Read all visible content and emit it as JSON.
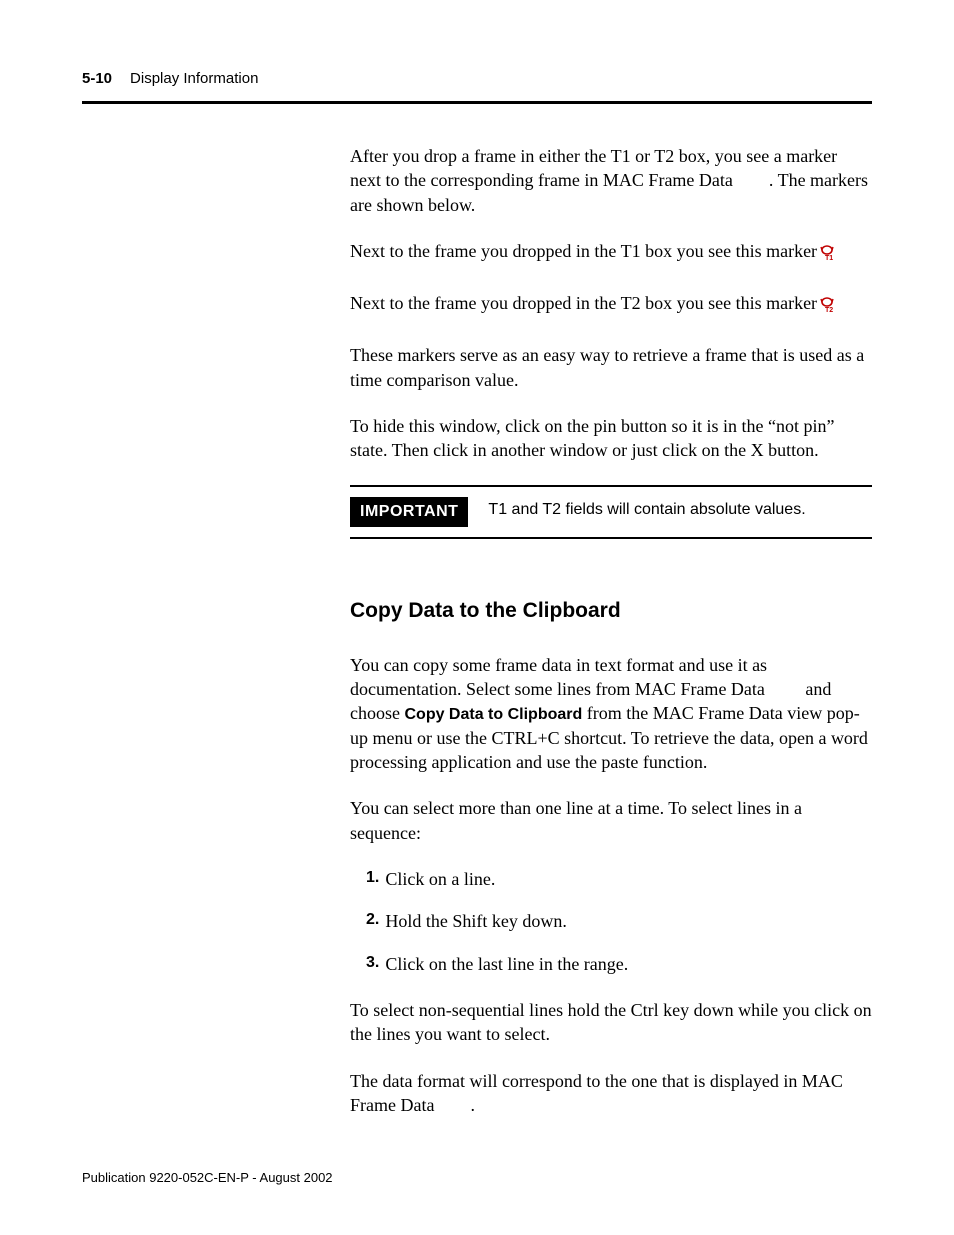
{
  "header": {
    "page_number": "5-10",
    "section": "Display Information"
  },
  "body": {
    "p1": "After you drop a frame in either the T1 or T2 box, you see a marker next to the corresponding frame in MAC Frame Data  . The markers are shown below.",
    "marker_t1_text": "Next to the frame you dropped in the T1 box you see this marker",
    "marker_t2_text": "Next to the frame you dropped in the T2 box you see this marker",
    "p2": "These markers serve as an easy way to retrieve a frame that is used as a time comparison value.",
    "p3": "To hide this window, click on the pin button so it is in the “not pin” state. Then click in another window or just click on the X button.",
    "important_label": "IMPORTANT",
    "important_text": "T1 and T2 fields will contain absolute values.",
    "subheading": "Copy Data to the Clipboard",
    "p4_pre": "You can copy some frame data in text format and use it as documentation. Select some lines from MAC Frame Data   and choose ",
    "p4_bold": "Copy Data to Clipboard",
    "p4_post": " from the MAC Frame Data view pop-up menu or use the CTRL+C shortcut. To retrieve the data, open a word processing application and use the paste function.",
    "p5": "You can select more than one line at a time. To select lines in a sequence:",
    "steps": [
      "Click on a line.",
      "Hold the Shift key down.",
      "Click on the last line in the range."
    ],
    "p6": "To select non-sequential lines hold the Ctrl key down while you click on the lines you want to select.",
    "p7": "The data format will correspond to the one that is displayed in MAC Frame Data  ."
  },
  "footer": {
    "publication": "Publication 9220-052C-EN-P - August 2002"
  }
}
